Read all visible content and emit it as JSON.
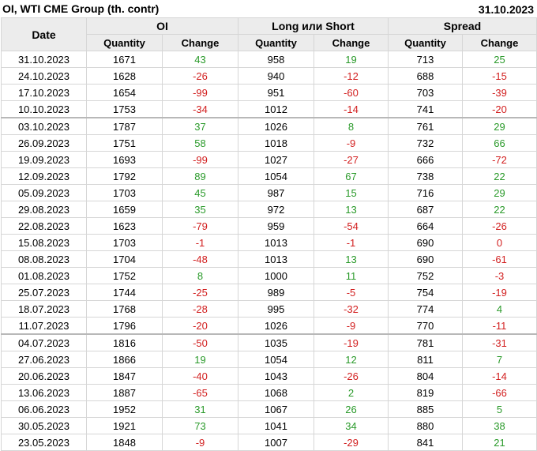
{
  "title": "OI, WTI CME Group (th. contr)",
  "date": "31.10.2023",
  "colors": {
    "positive": "#2a9a2a",
    "negative": "#d21f1f",
    "header_bg": "#ececec"
  },
  "headers": {
    "date": "Date",
    "groups": [
      "OI",
      "Long или Short",
      "Spread"
    ],
    "sub": [
      "Quantity",
      "Change",
      "Quantity",
      "Change",
      "Quantity",
      "Change"
    ]
  },
  "rows": [
    {
      "date": "31.10.2023",
      "oi_q": "1671",
      "oi_c": "43",
      "ls_q": "958",
      "ls_c": "19",
      "sp_q": "713",
      "sp_c": "25"
    },
    {
      "date": "24.10.2023",
      "oi_q": "1628",
      "oi_c": "-26",
      "ls_q": "940",
      "ls_c": "-12",
      "sp_q": "688",
      "sp_c": "-15"
    },
    {
      "date": "17.10.2023",
      "oi_q": "1654",
      "oi_c": "-99",
      "ls_q": "951",
      "ls_c": "-60",
      "sp_q": "703",
      "sp_c": "-39"
    },
    {
      "date": "10.10.2023",
      "oi_q": "1753",
      "oi_c": "-34",
      "ls_q": "1012",
      "ls_c": "-14",
      "sp_q": "741",
      "sp_c": "-20"
    },
    {
      "date": "03.10.2023",
      "oi_q": "1787",
      "oi_c": "37",
      "ls_q": "1026",
      "ls_c": "8",
      "sp_q": "761",
      "sp_c": "29"
    },
    {
      "date": "26.09.2023",
      "oi_q": "1751",
      "oi_c": "58",
      "ls_q": "1018",
      "ls_c": "-9",
      "sp_q": "732",
      "sp_c": "66"
    },
    {
      "date": "19.09.2023",
      "oi_q": "1693",
      "oi_c": "-99",
      "ls_q": "1027",
      "ls_c": "-27",
      "sp_q": "666",
      "sp_c": "-72"
    },
    {
      "date": "12.09.2023",
      "oi_q": "1792",
      "oi_c": "89",
      "ls_q": "1054",
      "ls_c": "67",
      "sp_q": "738",
      "sp_c": "22"
    },
    {
      "date": "05.09.2023",
      "oi_q": "1703",
      "oi_c": "45",
      "ls_q": "987",
      "ls_c": "15",
      "sp_q": "716",
      "sp_c": "29"
    },
    {
      "date": "29.08.2023",
      "oi_q": "1659",
      "oi_c": "35",
      "ls_q": "972",
      "ls_c": "13",
      "sp_q": "687",
      "sp_c": "22"
    },
    {
      "date": "22.08.2023",
      "oi_q": "1623",
      "oi_c": "-79",
      "ls_q": "959",
      "ls_c": "-54",
      "sp_q": "664",
      "sp_c": "-26"
    },
    {
      "date": "15.08.2023",
      "oi_q": "1703",
      "oi_c": "-1",
      "ls_q": "1013",
      "ls_c": "-1",
      "sp_q": "690",
      "sp_c": "0"
    },
    {
      "date": "08.08.2023",
      "oi_q": "1704",
      "oi_c": "-48",
      "ls_q": "1013",
      "ls_c": "13",
      "sp_q": "690",
      "sp_c": "-61"
    },
    {
      "date": "01.08.2023",
      "oi_q": "1752",
      "oi_c": "8",
      "ls_q": "1000",
      "ls_c": "11",
      "sp_q": "752",
      "sp_c": "-3"
    },
    {
      "date": "25.07.2023",
      "oi_q": "1744",
      "oi_c": "-25",
      "ls_q": "989",
      "ls_c": "-5",
      "sp_q": "754",
      "sp_c": "-19"
    },
    {
      "date": "18.07.2023",
      "oi_q": "1768",
      "oi_c": "-28",
      "ls_q": "995",
      "ls_c": "-32",
      "sp_q": "774",
      "sp_c": "4"
    },
    {
      "date": "11.07.2023",
      "oi_q": "1796",
      "oi_c": "-20",
      "ls_q": "1026",
      "ls_c": "-9",
      "sp_q": "770",
      "sp_c": "-11"
    },
    {
      "date": "04.07.2023",
      "oi_q": "1816",
      "oi_c": "-50",
      "ls_q": "1035",
      "ls_c": "-19",
      "sp_q": "781",
      "sp_c": "-31"
    },
    {
      "date": "27.06.2023",
      "oi_q": "1866",
      "oi_c": "19",
      "ls_q": "1054",
      "ls_c": "12",
      "sp_q": "811",
      "sp_c": "7"
    },
    {
      "date": "20.06.2023",
      "oi_q": "1847",
      "oi_c": "-40",
      "ls_q": "1043",
      "ls_c": "-26",
      "sp_q": "804",
      "sp_c": "-14"
    },
    {
      "date": "13.06.2023",
      "oi_q": "1887",
      "oi_c": "-65",
      "ls_q": "1068",
      "ls_c": "2",
      "sp_q": "819",
      "sp_c": "-66"
    },
    {
      "date": "06.06.2023",
      "oi_q": "1952",
      "oi_c": "31",
      "ls_q": "1067",
      "ls_c": "26",
      "sp_q": "885",
      "sp_c": "5"
    },
    {
      "date": "30.05.2023",
      "oi_q": "1921",
      "oi_c": "73",
      "ls_q": "1041",
      "ls_c": "34",
      "sp_q": "880",
      "sp_c": "38"
    },
    {
      "date": "23.05.2023",
      "oi_q": "1848",
      "oi_c": "-9",
      "ls_q": "1007",
      "ls_c": "-29",
      "sp_q": "841",
      "sp_c": "21"
    }
  ]
}
